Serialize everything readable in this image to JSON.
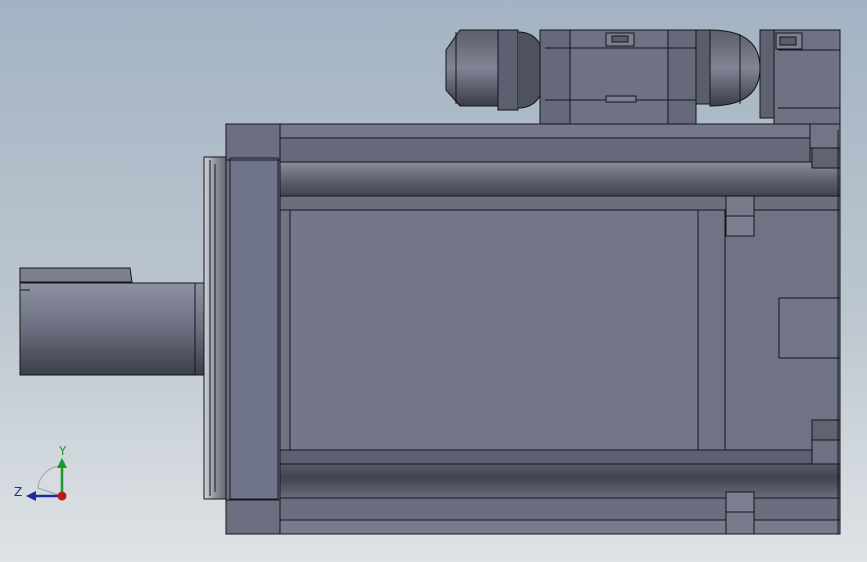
{
  "viewport": {
    "background_top": "#a3b3c3",
    "background_bottom": "#dfe3e6",
    "model": {
      "body_color": "#6f7384",
      "edge_color": "#14161c"
    },
    "triad": {
      "y_label": "Y",
      "z_label": "Z",
      "y_color": "#1a9a2e",
      "z_color": "#1c2c9c",
      "x_color": "#c01818"
    }
  }
}
